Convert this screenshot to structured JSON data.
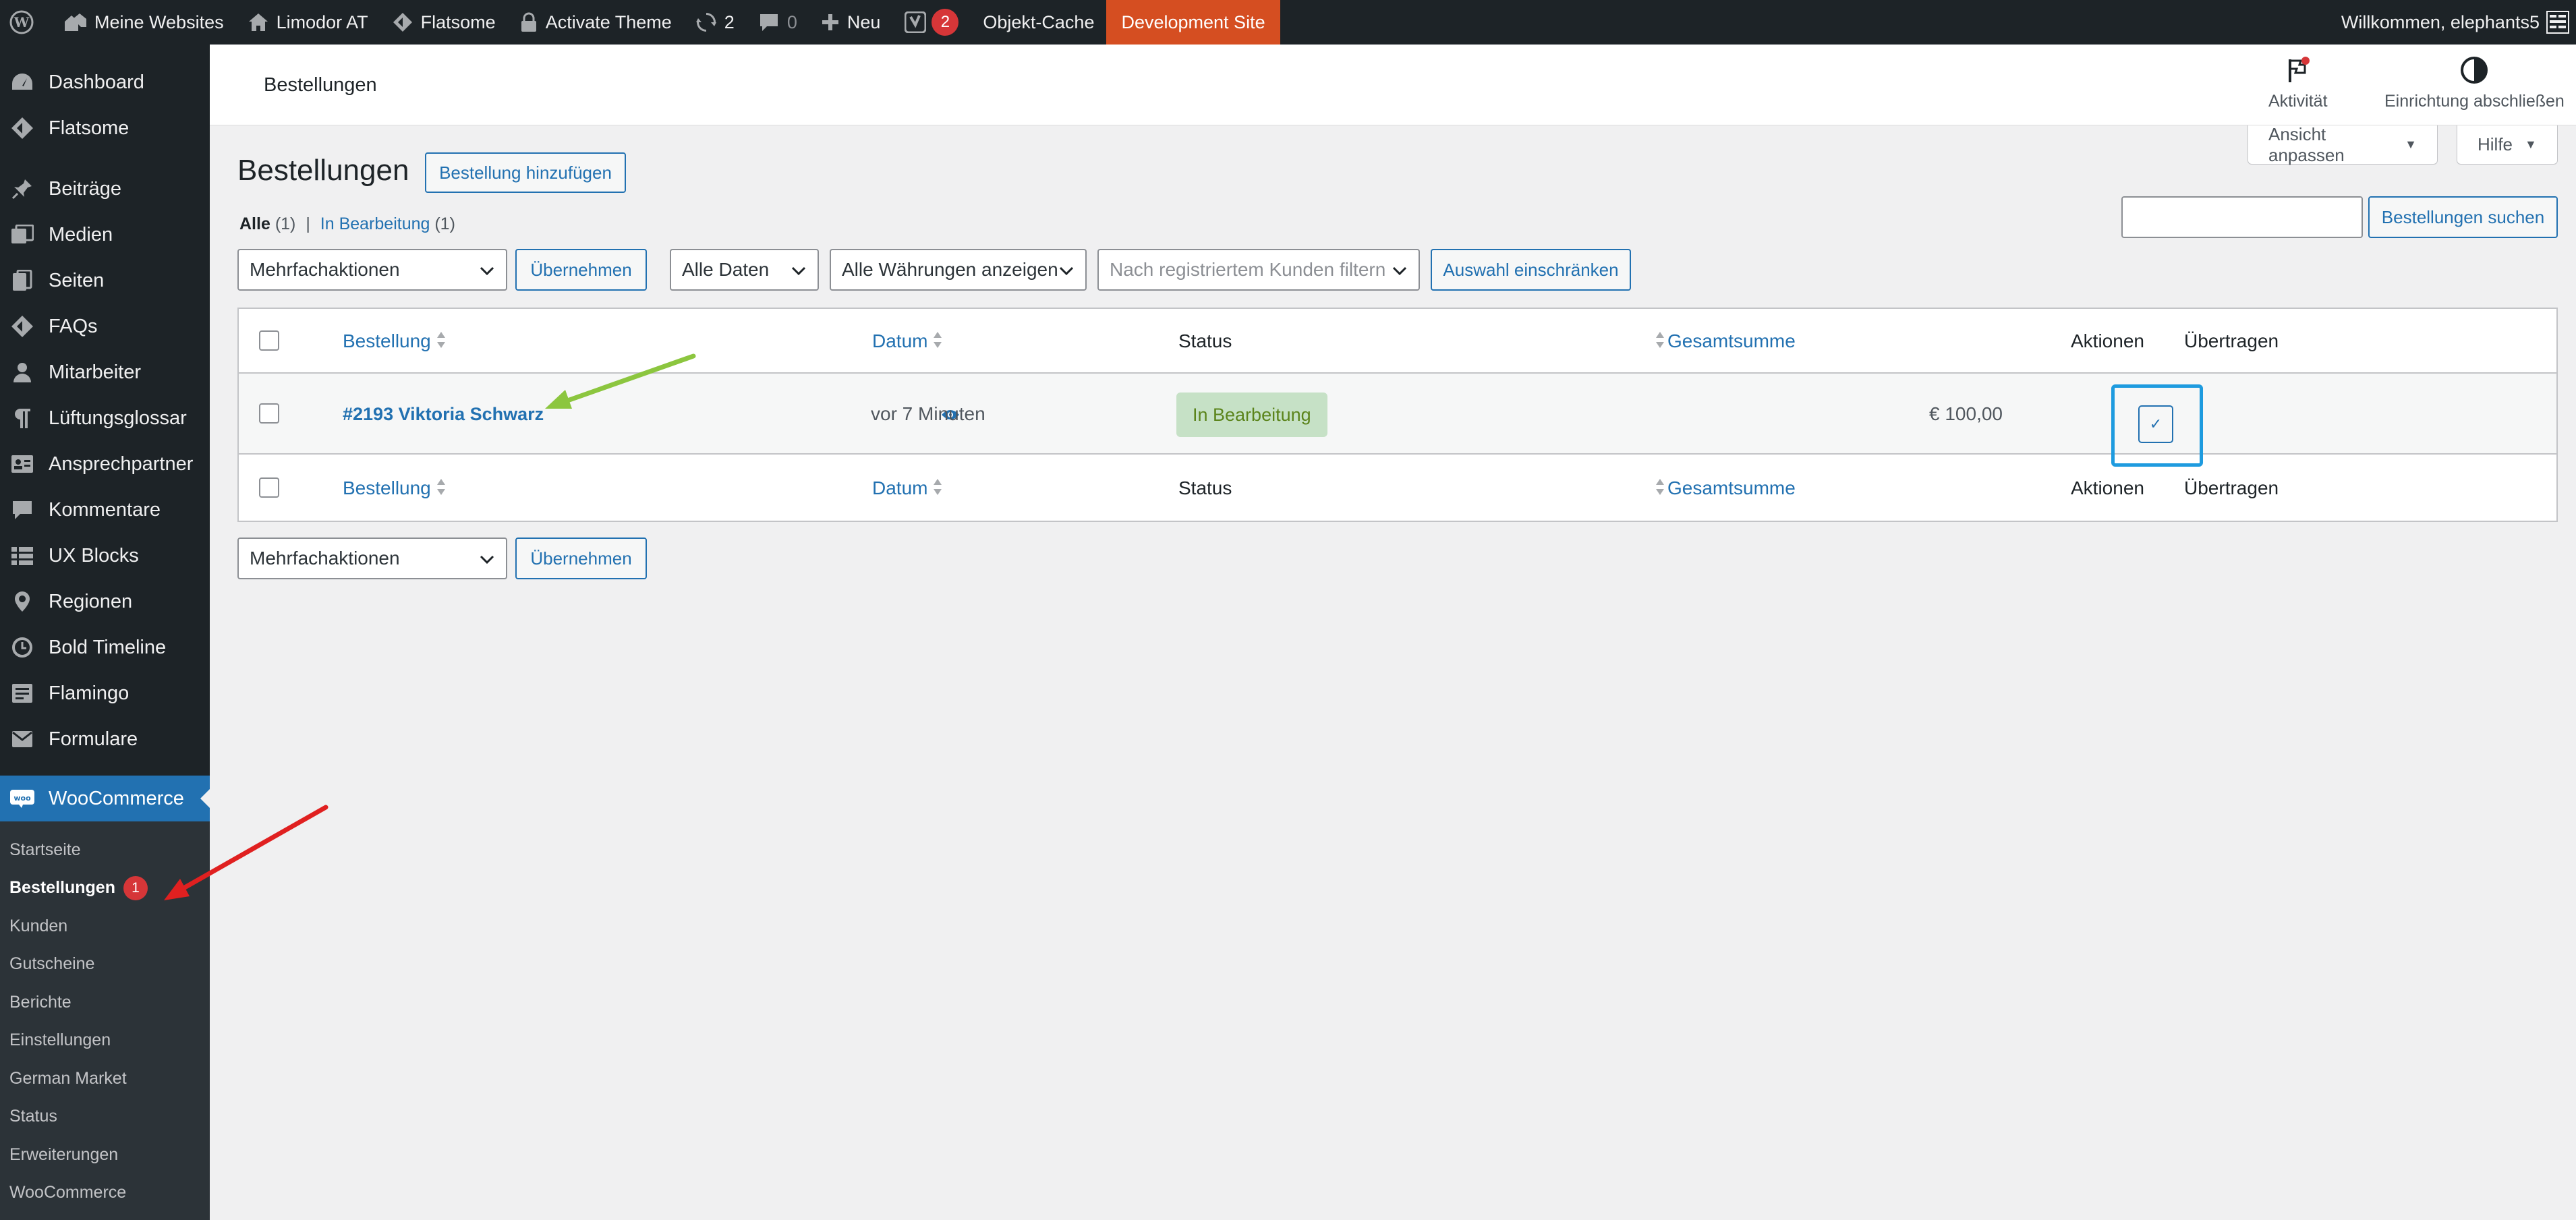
{
  "admin_bar": {
    "my_sites": "Meine Websites",
    "site_name": "Limodor AT",
    "flatsome": "Flatsome",
    "activate_theme": "Activate Theme",
    "updates_count": "2",
    "comments_count": "0",
    "new_label": "Neu",
    "yoast_badge": "2",
    "object_cache": "Objekt-Cache",
    "dev_site": "Development Site",
    "greeting": "Willkommen, elephants5"
  },
  "sidebar": {
    "items": [
      {
        "label": "Dashboard",
        "icon": "dashboard-icon"
      },
      {
        "label": "Flatsome",
        "icon": "flatsome-icon"
      },
      {
        "label": "Beiträge",
        "icon": "pin-icon"
      },
      {
        "label": "Medien",
        "icon": "media-icon"
      },
      {
        "label": "Seiten",
        "icon": "pages-icon"
      },
      {
        "label": "FAQs",
        "icon": "tag-icon"
      },
      {
        "label": "Mitarbeiter",
        "icon": "user-icon"
      },
      {
        "label": "Lüftungsglossar",
        "icon": "paragraph-icon"
      },
      {
        "label": "Ansprechpartner",
        "icon": "id-card-icon"
      },
      {
        "label": "Kommentare",
        "icon": "comment-icon"
      },
      {
        "label": "UX Blocks",
        "icon": "grid-icon"
      },
      {
        "label": "Regionen",
        "icon": "location-icon"
      },
      {
        "label": "Bold Timeline",
        "icon": "clock-icon"
      },
      {
        "label": "Flamingo",
        "icon": "feedback-icon"
      },
      {
        "label": "Formulare",
        "icon": "mail-icon"
      }
    ],
    "woocommerce": "WooCommerce",
    "submenu": [
      {
        "label": "Startseite"
      },
      {
        "label": "Bestellungen",
        "badge": "1"
      },
      {
        "label": "Kunden"
      },
      {
        "label": "Gutscheine"
      },
      {
        "label": "Berichte"
      },
      {
        "label": "Einstellungen"
      },
      {
        "label": "German Market"
      },
      {
        "label": "Status"
      },
      {
        "label": "Erweiterungen"
      },
      {
        "label": "WooCommerce"
      }
    ]
  },
  "header": {
    "title": "Bestellungen",
    "activity": "Aktivität",
    "finish_setup": "Einrichtung abschließen"
  },
  "screen_options": {
    "customize_view": "Ansicht anpassen",
    "help": "Hilfe"
  },
  "page": {
    "title": "Bestellungen",
    "add_order": "Bestellung hinzufügen",
    "filter_all": "Alle",
    "filter_all_count": "(1)",
    "filter_separator": "|",
    "filter_processing": "In Bearbeitung",
    "filter_processing_count": "(1)",
    "search_button": "Bestellungen suchen",
    "bulk_actions": "Mehrfachaktionen",
    "apply": "Übernehmen",
    "all_dates": "Alle Daten",
    "all_currencies": "Alle Währungen anzeigen",
    "customer_filter_placeholder": "Nach registriertem Kunden filtern",
    "filter_button": "Auswahl einschränken"
  },
  "table": {
    "columns": [
      "Bestellung",
      "Datum",
      "Status",
      "Gesamtsumme",
      "Aktionen",
      "Übertragen"
    ],
    "rows": [
      {
        "order": "#2193 Viktoria Schwarz",
        "date": "vor 7 Minuten",
        "status": "In Bearbeitung",
        "total": "€ 100,00",
        "action": "✓"
      }
    ]
  },
  "colors": {
    "admin_bar": "#1d2327",
    "accent": "#2271b1",
    "dev_site": "#d54e21",
    "status_processing_bg": "#c6e1c6",
    "status_processing_text": "#5b841b",
    "highlight_box": "#1e9bdf",
    "arrow_green": "#8cc63f",
    "arrow_red": "#e02020"
  }
}
